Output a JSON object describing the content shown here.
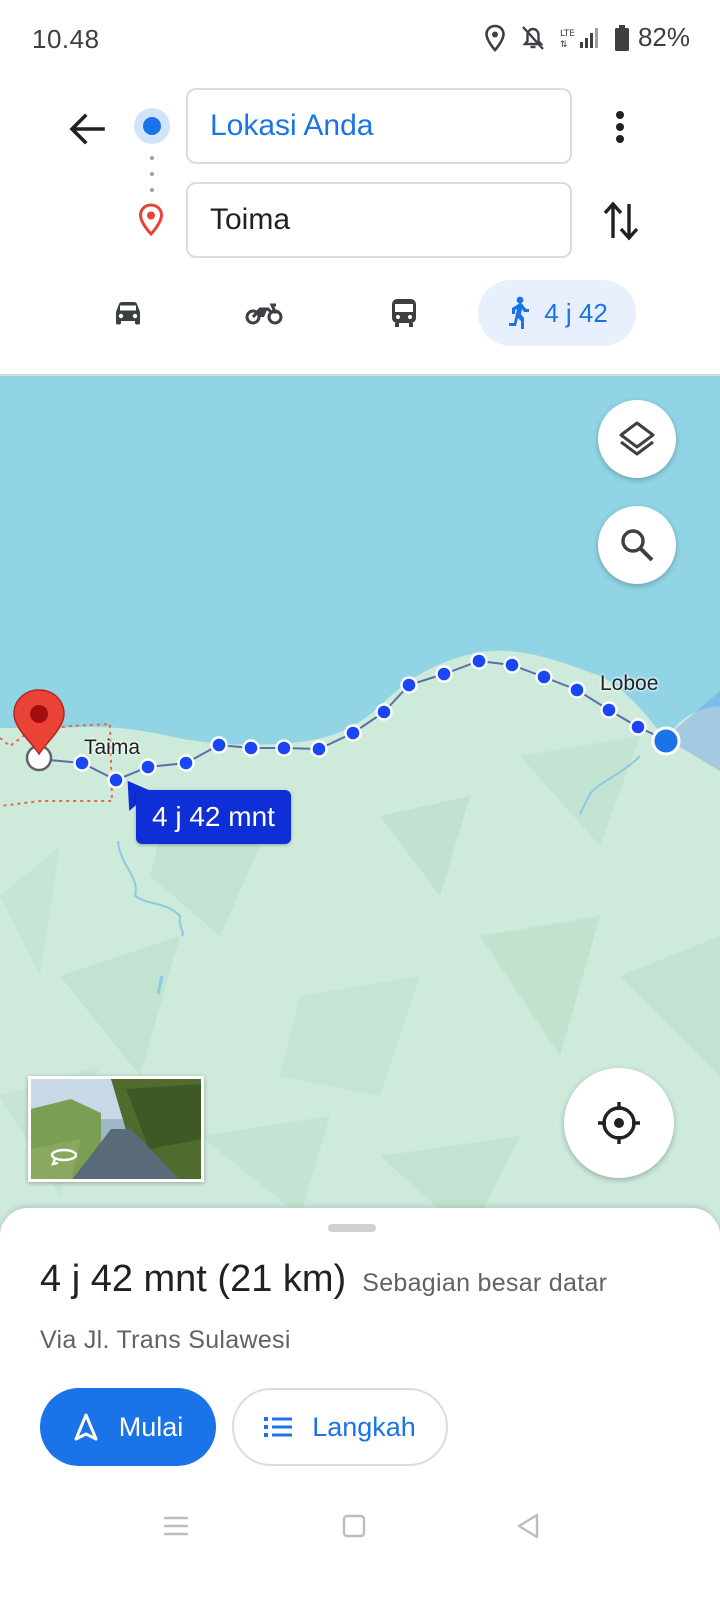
{
  "status_bar": {
    "time": "10.48",
    "battery": "82%"
  },
  "directions": {
    "origin_value": "Lokasi Anda",
    "destination_value": "Toima",
    "origin_icon": "blue-dot-icon",
    "destination_icon": "red-pin-icon"
  },
  "modes": {
    "selected": "walk",
    "walk_time": "4 j 42",
    "items": [
      {
        "name": "car",
        "icon": "car-icon"
      },
      {
        "name": "motorcycle",
        "icon": "motorcycle-icon"
      },
      {
        "name": "transit",
        "icon": "bus-icon"
      },
      {
        "name": "walk",
        "icon": "walking-icon"
      }
    ]
  },
  "map": {
    "labels": {
      "west": "Taima",
      "east": "Loboe"
    },
    "route_bubble": "4 j 42 mnt",
    "colors": {
      "water": "#91d4e6",
      "land": "#cdeadb",
      "route": "#1a47f5",
      "pin": "#ea4335"
    }
  },
  "sheet": {
    "duration": "4 j 42 mnt (21 km)",
    "terrain_note": "Sebagian besar datar",
    "via": "Via Jl. Trans Sulawesi",
    "start_label": "Mulai",
    "steps_label": "Langkah"
  }
}
